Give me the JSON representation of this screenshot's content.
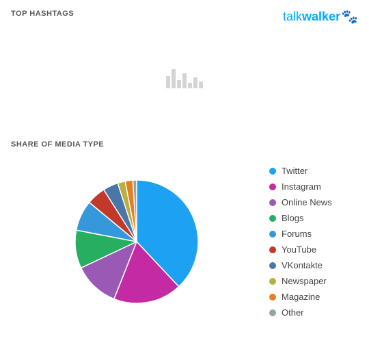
{
  "header": {
    "top_hashtags_label": "TOP HASHTAGS",
    "share_media_label": "SHARE OF MEDIA TYPE"
  },
  "logo": {
    "text_normal": "talk",
    "text_bold": "walker",
    "icon": "🐾"
  },
  "legend": {
    "items": [
      {
        "label": "Twitter",
        "color": "#1da1f2"
      },
      {
        "label": "Instagram",
        "color": "#c32aa3"
      },
      {
        "label": "Online News",
        "color": "#9b59b6"
      },
      {
        "label": "Blogs",
        "color": "#27ae60"
      },
      {
        "label": "Forums",
        "color": "#3498db"
      },
      {
        "label": "YouTube",
        "color": "#c0392b"
      },
      {
        "label": "VKontakte",
        "color": "#4a76a8"
      },
      {
        "label": "Newspaper",
        "color": "#b8b040"
      },
      {
        "label": "Magazine",
        "color": "#e67e22"
      },
      {
        "label": "Other",
        "color": "#95a5a6"
      }
    ]
  },
  "pie": {
    "segments": [
      {
        "label": "Twitter",
        "color": "#1da1f2",
        "percent": 38
      },
      {
        "label": "Instagram",
        "color": "#c32aa3",
        "percent": 18
      },
      {
        "label": "Online News",
        "color": "#9b59b6",
        "percent": 12
      },
      {
        "label": "Blogs",
        "color": "#27ae60",
        "percent": 10
      },
      {
        "label": "Forums",
        "color": "#3498db",
        "percent": 8
      },
      {
        "label": "YouTube",
        "color": "#c0392b",
        "percent": 5
      },
      {
        "label": "VKontakte",
        "color": "#4a76a8",
        "percent": 4
      },
      {
        "label": "Newspaper",
        "color": "#b8b040",
        "percent": 2
      },
      {
        "label": "Magazine",
        "color": "#e67e22",
        "percent": 2
      },
      {
        "label": "Other",
        "color": "#95a5a6",
        "percent": 1
      }
    ]
  }
}
